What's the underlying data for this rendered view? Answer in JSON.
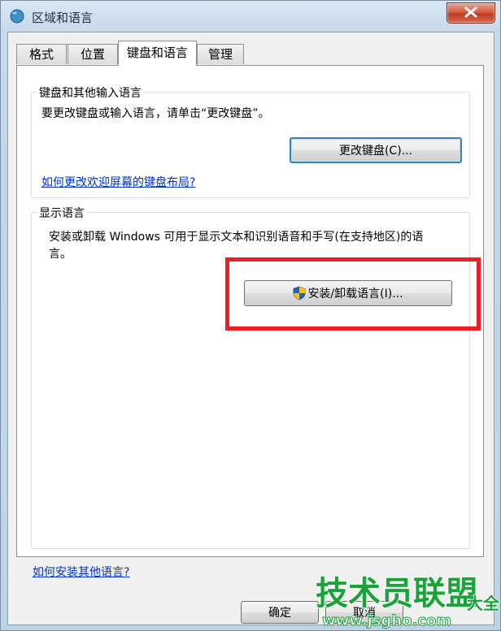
{
  "window": {
    "title": "区域和语言"
  },
  "tabs": [
    {
      "label": "格式"
    },
    {
      "label": "位置"
    },
    {
      "label": "键盘和语言"
    },
    {
      "label": "管理"
    }
  ],
  "keyboard_group": {
    "title": "键盘和其他输入语言",
    "description": "要更改键盘或输入语言，请单击“更改键盘”。",
    "change_button": "更改键盘(C)...",
    "welcome_link": "如何更改欢迎屏幕的键盘布局?"
  },
  "display_group": {
    "title": "显示语言",
    "description_line1": "安装或卸载 Windows 可用于显示文本和识别语音和手写(在支持地区)的语",
    "description_line2": "言。",
    "install_button": "安装/卸载语言(I)..."
  },
  "bottom_link": "如何安装其他语言?",
  "footer": {
    "ok_button": "确定",
    "cancel_button": "取消"
  },
  "watermark": {
    "brand": "技术员联盟",
    "suffix": "大全",
    "url": "www.jsgho.com"
  },
  "colors": {
    "highlight": "#ee1c24",
    "link": "#0033cc",
    "watermark_green": "#1aa33a"
  }
}
